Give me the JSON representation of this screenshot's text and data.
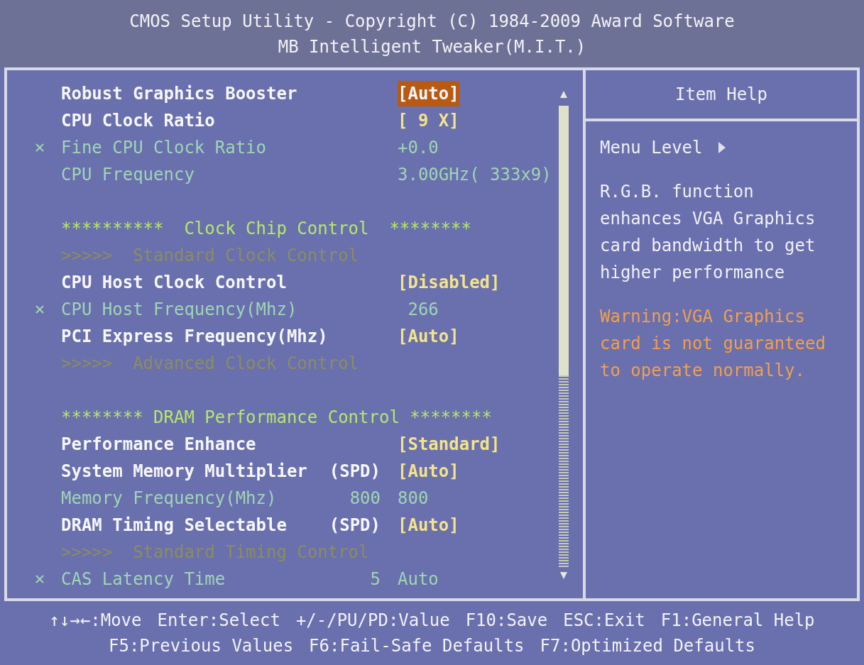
{
  "title_bar": {
    "lines": [
      "CMOS Setup Utility - Copyright (C) 1984-2009 Award Software",
      "MB Intelligent Tweaker(M.I.T.)"
    ]
  },
  "settings": [
    {
      "kind": "setting",
      "label": "Robust Graphics Booster",
      "value": "[Auto]",
      "selected": true
    },
    {
      "kind": "setting",
      "label": "CPU Clock Ratio",
      "value": "[ 9 X]",
      "selected": false
    },
    {
      "kind": "locked",
      "label": "Fine CPU Clock Ratio",
      "value": "+0.0",
      "selected": false
    },
    {
      "kind": "info",
      "label": "CPU Frequency",
      "value": "3.00GHz( 333x9)",
      "selected": false
    },
    {
      "kind": "blank"
    },
    {
      "kind": "header",
      "label": "**********  Clock Chip Control  ********"
    },
    {
      "kind": "subheader",
      "label": ">>>>>  Standard Clock Control"
    },
    {
      "kind": "setting",
      "label": "CPU Host Clock Control",
      "value": "[Disabled]",
      "selected": false
    },
    {
      "kind": "locked",
      "label": "CPU Host Frequency(Mhz)",
      "value": " 266",
      "selected": false
    },
    {
      "kind": "setting",
      "label": "PCI Express Frequency(Mhz)",
      "value": "[Auto]",
      "selected": false
    },
    {
      "kind": "subheader",
      "label": ">>>>>  Advanced Clock Control"
    },
    {
      "kind": "blank"
    },
    {
      "kind": "header",
      "label": "******** DRAM Performance Control ********"
    },
    {
      "kind": "setting",
      "label": "Performance Enhance",
      "value": "[Standard]",
      "selected": false
    },
    {
      "kind": "setting",
      "label": "System Memory Multiplier",
      "column_2": "(SPD)",
      "value": "[Auto]",
      "selected": false
    },
    {
      "kind": "info",
      "label": "Memory Frequency(Mhz)",
      "column_2": "800",
      "value": "800",
      "selected": false
    },
    {
      "kind": "setting",
      "label": "DRAM Timing Selectable",
      "column_2": "(SPD)",
      "value": "[Auto]",
      "selected": false
    },
    {
      "kind": "subheader",
      "label": ">>>>>  Standard Timing Control"
    },
    {
      "kind": "locked",
      "label": "CAS Latency Time",
      "column_2": "5",
      "value": "Auto",
      "selected": false
    }
  ],
  "item_help": {
    "title": "Item Help",
    "menu_level": "Menu Level",
    "description": "R.G.B. function enhances VGA Graphics card bandwidth to get higher performance",
    "warning": "Warning:VGA Graphics card is not guaranteed to operate normally."
  },
  "key_hints": [
    [
      "↑↓→←:Move",
      "Enter:Select",
      "+/-/PU/PD:Value",
      "F10:Save",
      "ESC:Exit",
      "F1:General Help"
    ],
    [
      "F5:Previous Values",
      "F6:Fail-Safe Defaults",
      "F7:Optimized Defaults"
    ]
  ]
}
